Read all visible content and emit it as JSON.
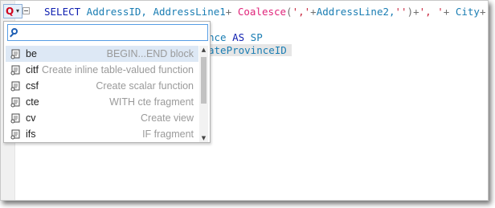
{
  "editor": {
    "line1": {
      "select_kw": "SELECT",
      "p1": " AddressID, AddressLine1",
      "op1": "+",
      "coalesce": " Coalesce",
      "p2": "(",
      "s1": "','",
      "op2": "+",
      "p3": "AddressLine2,",
      "s2": "''",
      "p4": ")",
      "op3": "+",
      "s3": "', '",
      "op4": "+",
      "p5": " City",
      "op5": "+",
      "s4": "', '",
      "op6": "+"
    },
    "line2": {
      "text": "nce",
      "as_kw": " AS",
      "alias": " SP"
    },
    "line3": {
      "text": "ateProvinceID"
    }
  },
  "snippet_button": {
    "glyph": "Q",
    "arrow": "▾"
  },
  "popup": {
    "search": {
      "value": "",
      "placeholder": ""
    },
    "items": [
      {
        "name": "be",
        "desc": "BEGIN...END block",
        "selected": true
      },
      {
        "name": "citf",
        "desc": "Create inline table-valued function",
        "selected": false
      },
      {
        "name": "csf",
        "desc": "Create scalar function",
        "selected": false
      },
      {
        "name": "cte",
        "desc": "WITH cte fragment",
        "selected": false
      },
      {
        "name": "cv",
        "desc": "Create view",
        "selected": false
      },
      {
        "name": "ifs",
        "desc": "IF fragment",
        "selected": false
      }
    ],
    "scroll_up": "▲",
    "scroll_down": "▼"
  },
  "icons": {
    "snippet": "snippet-scroll-icon",
    "search": "search-icon"
  },
  "colors": {
    "selection": "#dde8f5",
    "accent": "#569de5",
    "keyword": "#0f1fb0",
    "string": "#c8243c"
  }
}
